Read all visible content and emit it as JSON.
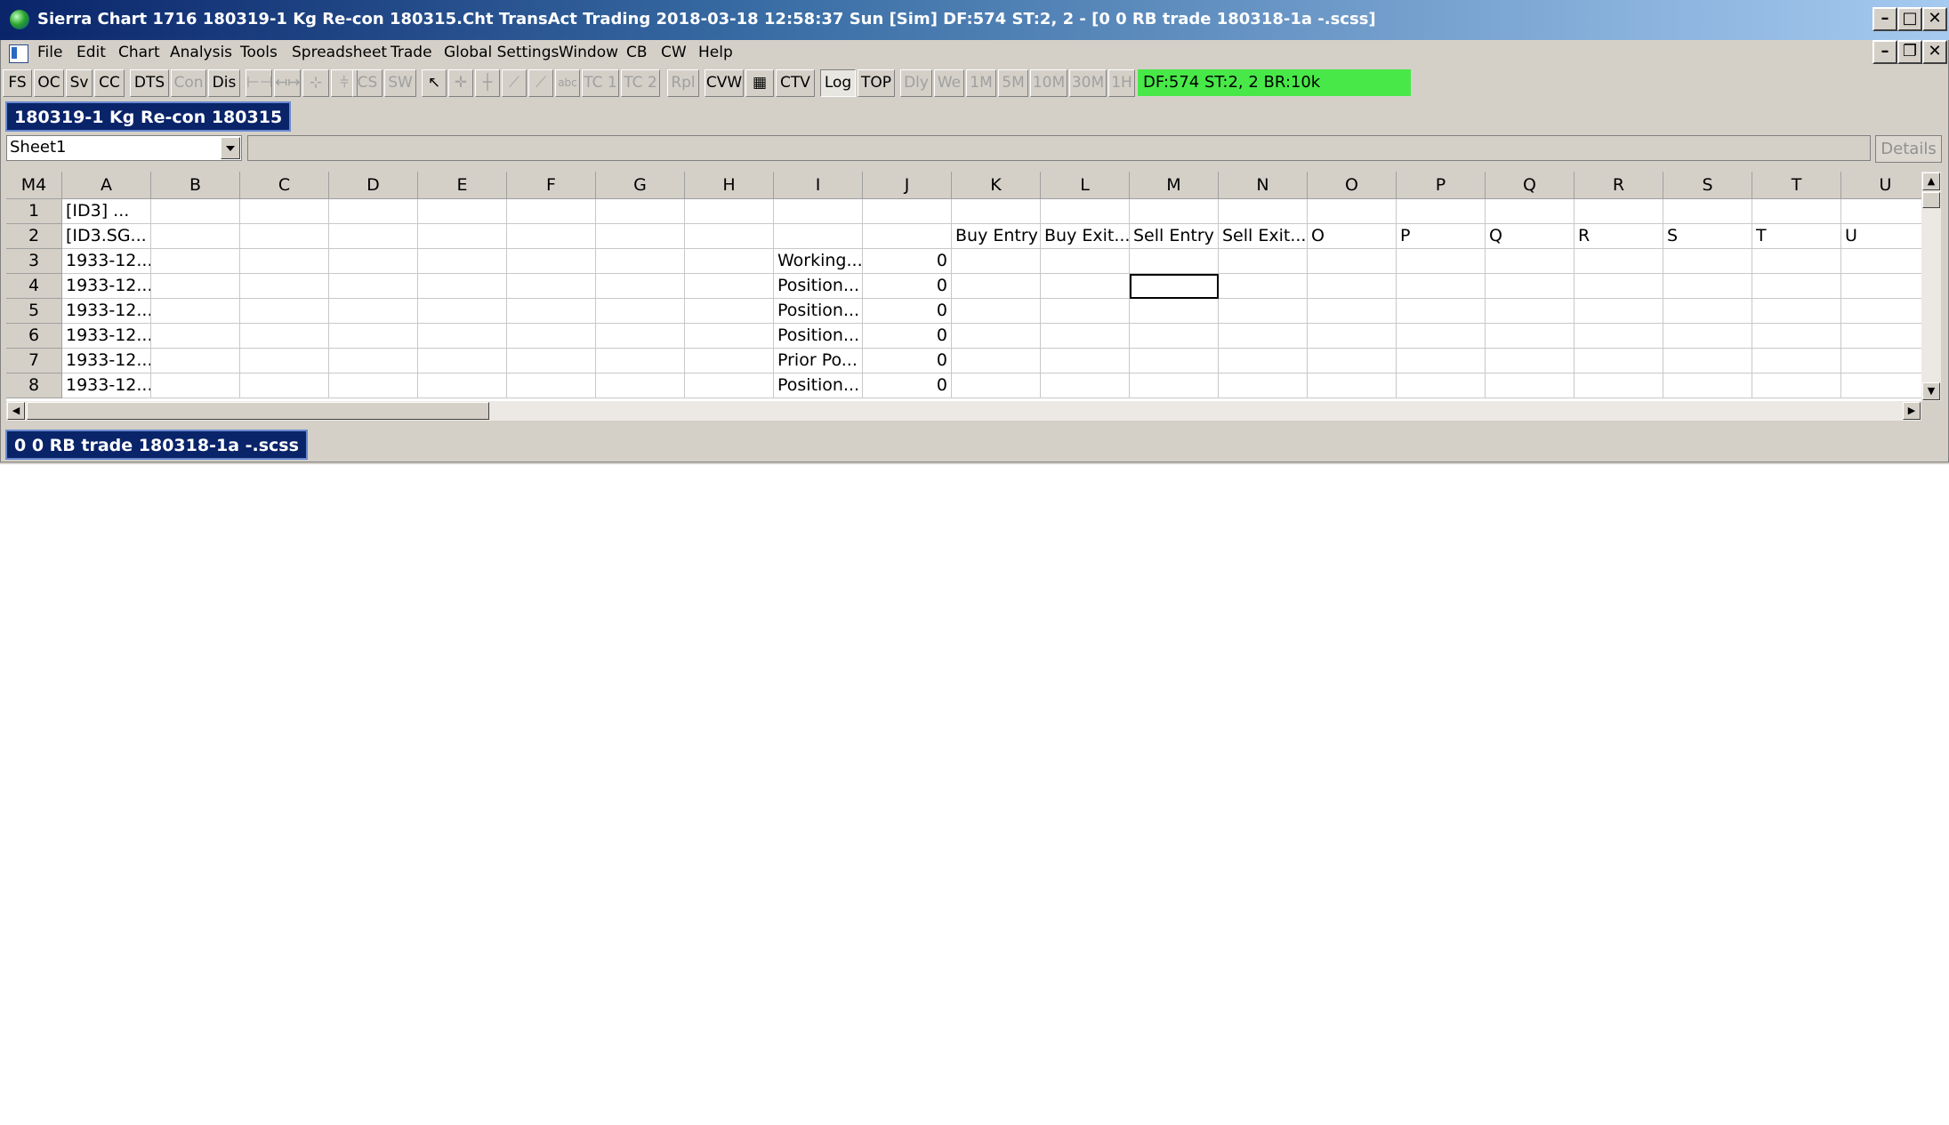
{
  "window": {
    "title": "Sierra Chart 1716 180319-1  Kg Re-con 180315.Cht  TransAct Trading 2018-03-18  12:58:37 Sun [Sim]  DF:574  ST:2, 2 - [0 0 RB trade 180318-1a -.scss]",
    "caption_buttons": {
      "minimize": "–",
      "maximize": "□",
      "close": "✕",
      "restore": "❐"
    }
  },
  "menu": [
    {
      "label": "File"
    },
    {
      "label": "Edit"
    },
    {
      "label": "Chart"
    },
    {
      "label": "Analysis"
    },
    {
      "label": "Tools"
    },
    {
      "label": "Spreadsheet"
    },
    {
      "label": "Trade"
    },
    {
      "label": "Global Settings"
    },
    {
      "label": "Window"
    },
    {
      "label": "CB"
    },
    {
      "label": "CW"
    },
    {
      "label": "Help"
    }
  ],
  "toolbar": [
    {
      "label": "FS",
      "enabled": true
    },
    {
      "label": "OC",
      "enabled": true
    },
    {
      "label": "Sv",
      "enabled": true
    },
    {
      "label": "CC",
      "enabled": true
    },
    {
      "label": "DTS",
      "enabled": true
    },
    {
      "label": "Con",
      "enabled": false
    },
    {
      "label": "Dis",
      "enabled": true
    },
    {
      "label": "CS",
      "enabled": false
    },
    {
      "label": "SW",
      "enabled": false
    },
    {
      "label": "abc",
      "enabled": false
    },
    {
      "label": "TC 1",
      "enabled": false
    },
    {
      "label": "TC 2",
      "enabled": false
    },
    {
      "label": "Rpl",
      "enabled": false
    },
    {
      "label": "CVW",
      "enabled": true
    },
    {
      "label": "CTV",
      "enabled": true
    },
    {
      "label": "Log",
      "enabled": true
    },
    {
      "label": "TOP",
      "enabled": true
    },
    {
      "label": "Dly",
      "enabled": false
    },
    {
      "label": "We",
      "enabled": false
    },
    {
      "label": "1M",
      "enabled": false
    },
    {
      "label": "5M",
      "enabled": false
    },
    {
      "label": "10M",
      "enabled": false
    },
    {
      "label": "30M",
      "enabled": false
    },
    {
      "label": "1H",
      "enabled": false
    }
  ],
  "status_indicator": {
    "text": "DF:574  ST:2, 2  BR:10k",
    "color": "#48e848"
  },
  "chart_tab": {
    "label": "180319-1  Kg Re-con 180315"
  },
  "sheet_selector": {
    "value": "Sheet1"
  },
  "details_button": {
    "label": "Details"
  },
  "grid": {
    "cell_ref": "M4",
    "columns": [
      "A",
      "B",
      "C",
      "D",
      "E",
      "F",
      "G",
      "H",
      "I",
      "J",
      "K",
      "L",
      "M",
      "N",
      "O",
      "P",
      "Q",
      "R",
      "S",
      "T",
      "U"
    ],
    "rows": [
      {
        "num": "1",
        "cells": {
          "A": " [ID3] ..."
        }
      },
      {
        "num": "2",
        "cells": {
          "A": "[ID3.SG...",
          "K": "Buy Entry",
          "L": "Buy Exit...",
          "M": "Sell Entry",
          "N": "Sell Exit...",
          "O": "O",
          "P": "P",
          "Q": "Q",
          "R": "R",
          "S": "S",
          "T": "T",
          "U": "U"
        }
      },
      {
        "num": "3",
        "cells": {
          "A": "1933-12...",
          "I": "Working...",
          "J": "0"
        }
      },
      {
        "num": "4",
        "cells": {
          "A": "1933-12...",
          "I": "Position...",
          "J": "0"
        }
      },
      {
        "num": "5",
        "cells": {
          "A": "1933-12...",
          "I": "Position...",
          "J": "0"
        }
      },
      {
        "num": "6",
        "cells": {
          "A": "1933-12...",
          "I": "Position...",
          "J": "0"
        }
      },
      {
        "num": "7",
        "cells": {
          "A": "1933-12...",
          "I": "Prior Po...",
          "J": "0"
        }
      },
      {
        "num": "8",
        "cells": {
          "A": "1933-12...",
          "I": "Position...",
          "J": "0"
        }
      }
    ],
    "selected_cell": "M4"
  },
  "spreadsheet_tab": {
    "label": "0 0 RB trade 180318-1a -.scss"
  }
}
